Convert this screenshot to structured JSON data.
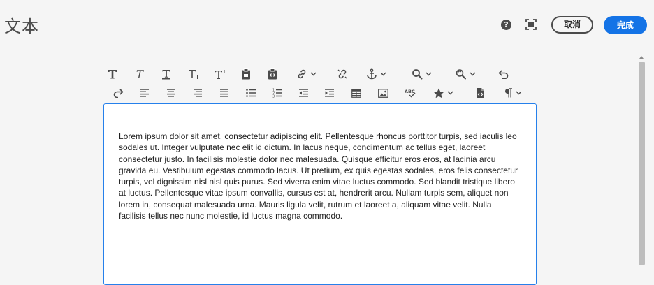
{
  "header": {
    "title": "文本",
    "help_icon": "help-icon",
    "fullscreen_icon": "fullscreen-icon",
    "cancel_label": "取消",
    "done_label": "完成",
    "accent_color": "#1473e6"
  },
  "toolbar": {
    "row1": [
      "bold-icon",
      "italic-icon",
      "underline-icon",
      "subscript-icon",
      "superscript-icon",
      "paste-icon",
      "paste-code-icon",
      "link-icon",
      "unlink-icon",
      "anchor-icon",
      "find-icon",
      "find-replace-icon",
      "undo-icon"
    ],
    "row2": [
      "redo-icon",
      "align-left-icon",
      "align-center-icon",
      "align-right-icon",
      "justify-icon",
      "bullet-list-icon",
      "numbered-list-icon",
      "outdent-icon",
      "indent-icon",
      "table-icon",
      "image-icon",
      "spellcheck-icon",
      "special-char-icon",
      "source-edit-icon",
      "paragraph-format-icon"
    ]
  },
  "editor": {
    "content": "Lorem ipsum dolor sit amet, consectetur adipiscing elit. Pellentesque rhoncus porttitor turpis, sed iaculis leo sodales ut. Integer vulputate nec elit id dictum. In lacus neque, condimentum ac tellus eget, laoreet consectetur justo. In facilisis molestie dolor nec malesuada. Quisque efficitur eros eros, at lacinia arcu gravida eu. Vestibulum egestas commodo lacus. Ut pretium, ex quis egestas sodales, eros felis consectetur turpis, vel dignissim nisl nisl quis purus. Sed viverra enim vitae luctus commodo. Sed blandit tristique libero at luctus. Pellentesque vitae ipsum convallis, cursus est at, hendrerit arcu. Nullam turpis sem, aliquet non lorem in, consequat malesuada urna. Mauris ligula velit, rutrum et laoreet a, aliquam vitae velit. Nulla facilisis tellus nec nunc molestie, id luctus magna commodo.",
    "border_color": "#2680eb"
  }
}
